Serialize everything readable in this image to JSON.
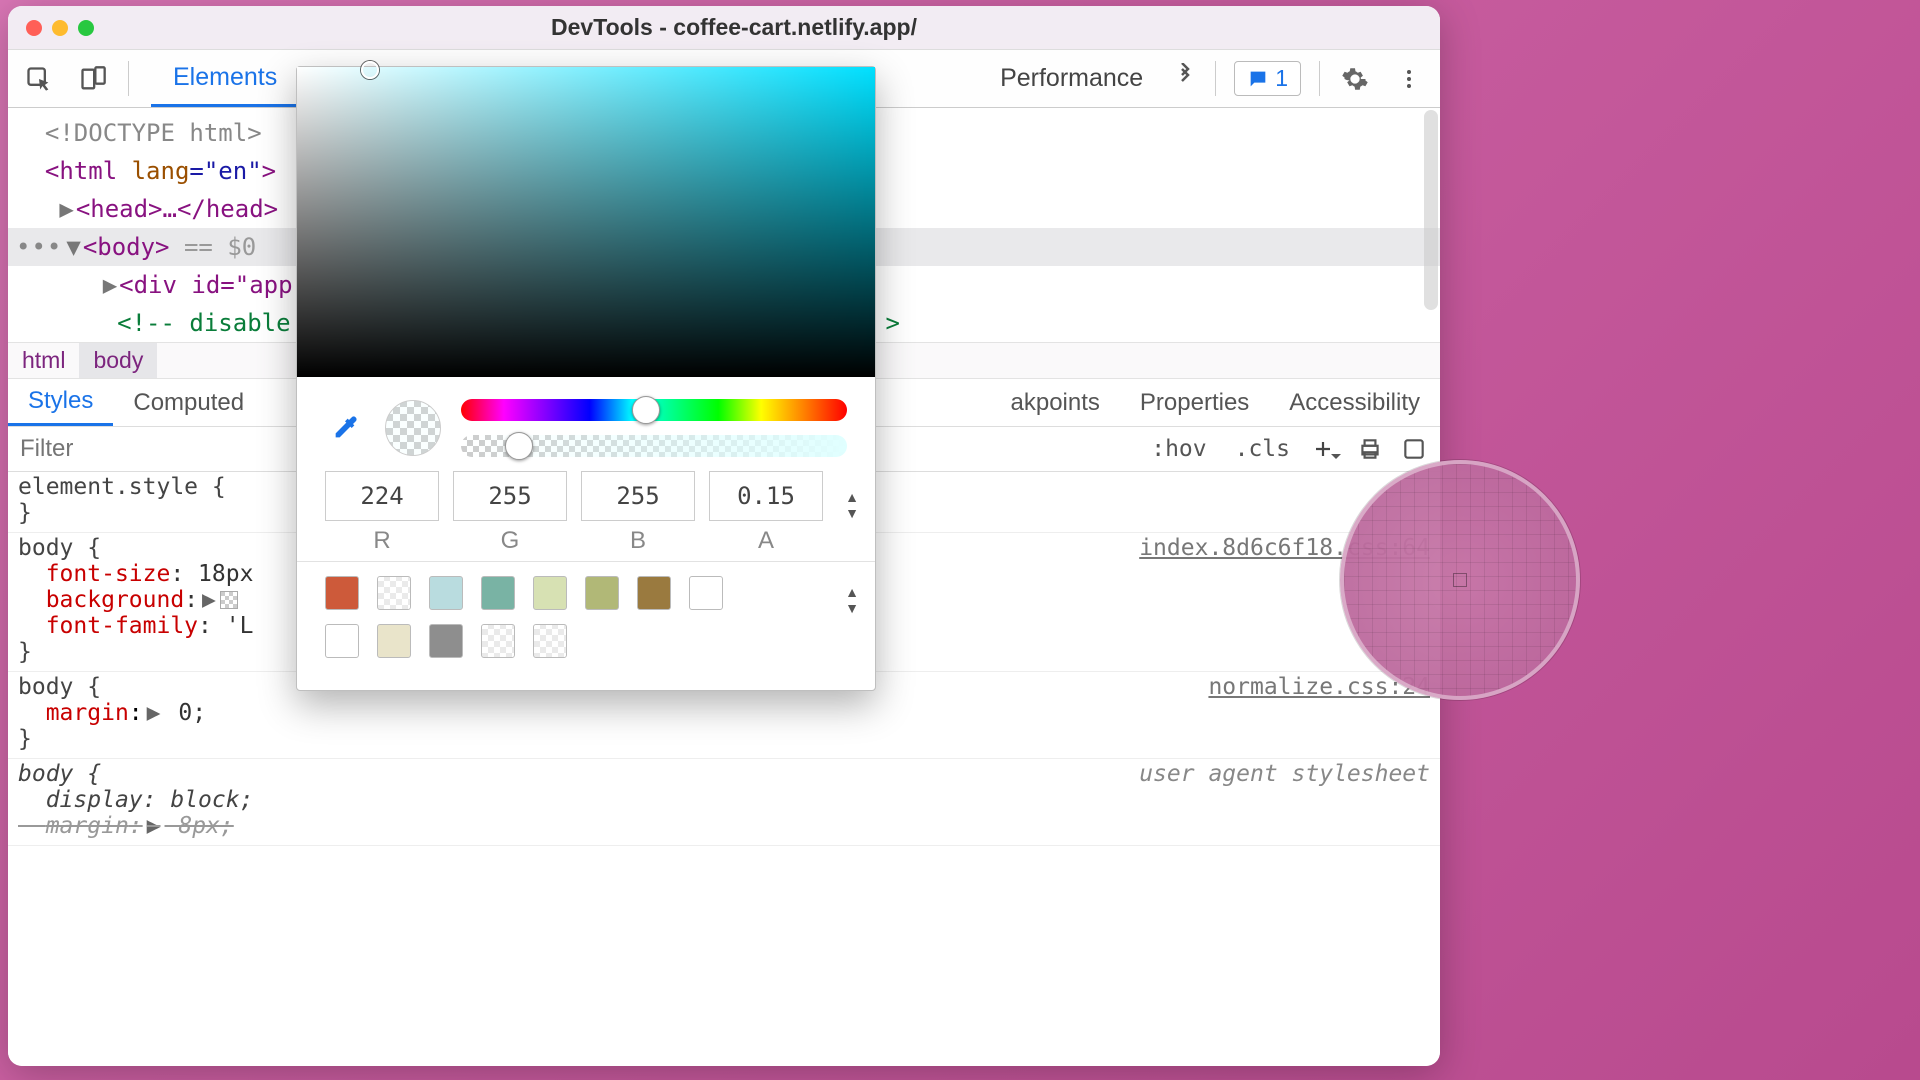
{
  "window_title": "DevTools - coffee-cart.netlify.app/",
  "toolbar": {
    "tabs": [
      "Elements",
      "Performance"
    ],
    "issues_count": "1"
  },
  "dom": {
    "doctype": "<!DOCTYPE html>",
    "html_open": "<",
    "html_tag": "html",
    "html_attr": " lang",
    "html_val": "=\"en\"",
    "html_close": ">",
    "head": "<head>…</head>",
    "body_open": "<body>",
    "eq0": " == $0",
    "div_app": "<div id=\"app\"",
    "comment": "<!-- disable",
    "comment_end": ">"
  },
  "crumbs": [
    "html",
    "body"
  ],
  "subtabs": {
    "a": "Styles",
    "b": "Computed",
    "c": "akpoints",
    "d": "Properties",
    "e": "Accessibility"
  },
  "filter": {
    "placeholder": "Filter",
    "hov": ":hov",
    "cls": ".cls"
  },
  "styles": {
    "element_style_open": "element.style {",
    "close_brace": "}",
    "body1_sel": "body {",
    "body1_src": "index.8d6c6f18.css:64",
    "font_size_p": "font-size",
    "font_size_v": ": 18px",
    "background_p": "background",
    "background_v": ":",
    "font_family_p": "font-family",
    "font_family_v": ": 'L",
    "body2_sel": "body {",
    "body2_src": "normalize.css:24",
    "margin_p": "margin",
    "margin_v": " 0;",
    "body3_sel": "body {",
    "body3_src": "user agent stylesheet",
    "display_p": "display",
    "display_v": ": block;",
    "margin2_p": "margin",
    "margin2_v": " 8px;"
  },
  "picker": {
    "r": "224",
    "g": "255",
    "b": "255",
    "a": "0.15",
    "r_label": "R",
    "g_label": "G",
    "b_label": "B",
    "a_label": "A",
    "swatches_row1": [
      "#cd5a3a",
      "checker",
      "#b9dcdf",
      "#79b3a4",
      "#d7e1b3",
      "#b1b877",
      "#9a7a3f",
      "#ffffff"
    ],
    "swatches_row2": [
      "#ffffff",
      "#e9e4ca",
      "#8e8e8e",
      "checker",
      "checker"
    ]
  }
}
